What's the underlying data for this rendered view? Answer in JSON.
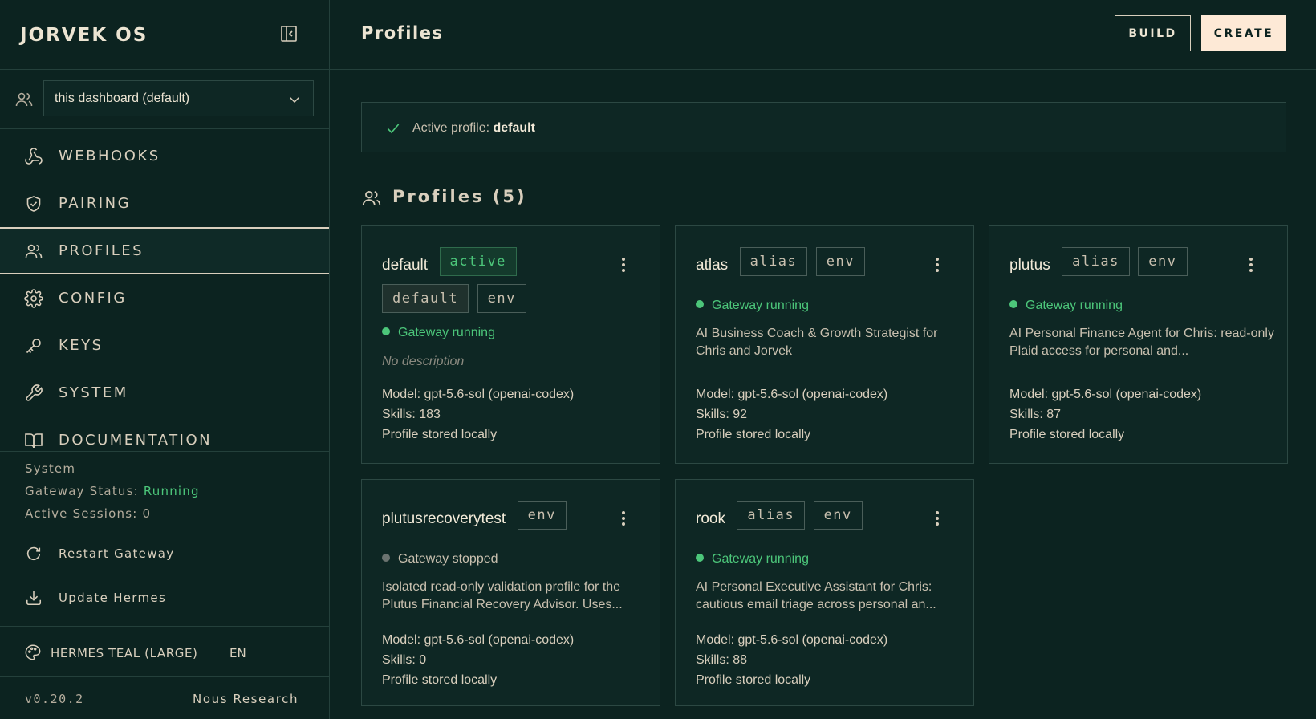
{
  "app": {
    "brand": "JORVEK OS"
  },
  "sidebar": {
    "profile_select": {
      "value": "this dashboard (default)"
    },
    "nav": [
      {
        "label": "WEBHOOKS",
        "icon": "webhook-icon"
      },
      {
        "label": "PAIRING",
        "icon": "shield-check-icon"
      },
      {
        "label": "PROFILES",
        "icon": "users-icon",
        "active": true
      },
      {
        "label": "CONFIG",
        "icon": "gear-icon"
      },
      {
        "label": "KEYS",
        "icon": "key-icon"
      },
      {
        "label": "SYSTEM",
        "icon": "wrench-icon"
      },
      {
        "label": "DOCUMENTATION",
        "icon": "book-icon"
      }
    ],
    "system": {
      "heading": "System",
      "gateway_label": "Gateway Status:",
      "gateway_value": "Running",
      "sessions_label": "Active Sessions:",
      "sessions_value": "0"
    },
    "actions": {
      "restart": "Restart Gateway",
      "update": "Update Hermes"
    },
    "theme": "HERMES TEAL (LARGE)",
    "language": "EN",
    "version": "v0.20.2",
    "vendor": "Nous Research"
  },
  "header": {
    "title": "Profiles",
    "build_label": "BUILD",
    "create_label": "CREATE"
  },
  "banner": {
    "prefix": "Active profile:",
    "profile": "default"
  },
  "section": {
    "title": "Profiles (5)"
  },
  "cards": [
    {
      "name": "default",
      "tags": [
        {
          "label": "active",
          "kind": "active"
        },
        {
          "label": "default",
          "kind": "def"
        },
        {
          "label": "env",
          "kind": "plain"
        }
      ],
      "status": "Gateway running",
      "running": true,
      "description": "No description",
      "description_empty": true,
      "model": "Model: gpt-5.6-sol (openai-codex)",
      "skills": "Skills: 183",
      "storage": "Profile stored locally"
    },
    {
      "name": "atlas",
      "tags": [
        {
          "label": "alias",
          "kind": "plain"
        },
        {
          "label": "env",
          "kind": "plain"
        }
      ],
      "status": "Gateway running",
      "running": true,
      "description": "AI Business Coach & Growth Strategist for Chris and Jorvek",
      "model": "Model: gpt-5.6-sol (openai-codex)",
      "skills": "Skills: 92",
      "storage": "Profile stored locally"
    },
    {
      "name": "plutus",
      "tags": [
        {
          "label": "alias",
          "kind": "plain"
        },
        {
          "label": "env",
          "kind": "plain"
        }
      ],
      "status": "Gateway running",
      "running": true,
      "description": "AI Personal Finance Agent for Chris: read-only Plaid access for personal and...",
      "model": "Model: gpt-5.6-sol (openai-codex)",
      "skills": "Skills: 87",
      "storage": "Profile stored locally"
    },
    {
      "name": "plutusrecoverytest",
      "tags": [
        {
          "label": "env",
          "kind": "plain"
        }
      ],
      "status": "Gateway stopped",
      "running": false,
      "description": "Isolated read-only validation profile for the Plutus Financial Recovery Advisor. Uses...",
      "model": "Model: gpt-5.6-sol (openai-codex)",
      "skills": "Skills: 0",
      "storage": "Profile stored locally"
    },
    {
      "name": "rook",
      "tags": [
        {
          "label": "alias",
          "kind": "plain"
        },
        {
          "label": "env",
          "kind": "plain"
        }
      ],
      "status": "Gateway running",
      "running": true,
      "description": "AI Personal Executive Assistant for Chris: cautious email triage across personal an...",
      "model": "Model: gpt-5.6-sol (openai-codex)",
      "skills": "Skills: 88",
      "storage": "Profile stored locally"
    }
  ],
  "colors": {
    "accent": "#fde9d6",
    "running": "#4cc67a",
    "background": "#0c2320"
  }
}
